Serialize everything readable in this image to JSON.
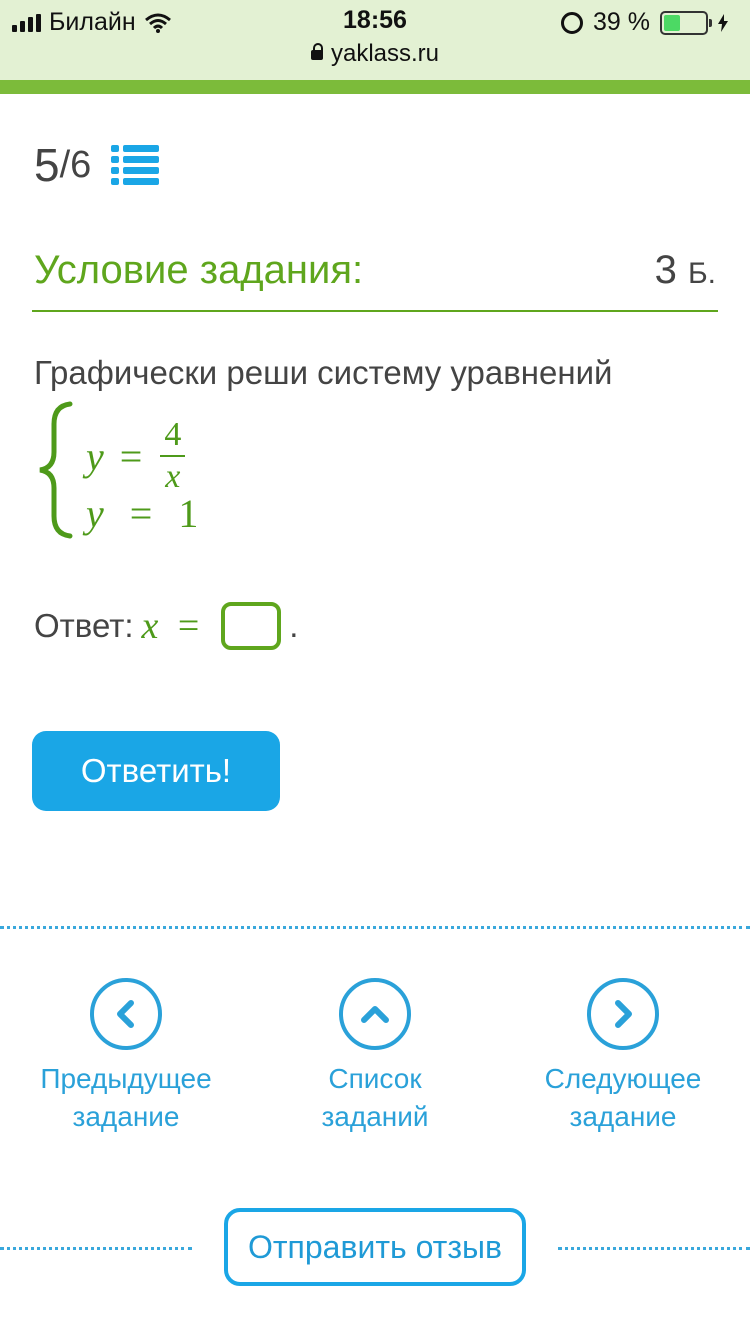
{
  "status_bar": {
    "carrier": "Билайн",
    "time": "18:56",
    "battery_percent": "39 %",
    "battery_level": 0.39,
    "url": "yaklass.ru"
  },
  "progress": {
    "current": "5",
    "total": "6"
  },
  "condition": {
    "title": "Условие задания:",
    "score": "3",
    "score_unit": "Б."
  },
  "task": {
    "text": "Графически реши систему уравнений",
    "eq1_left": "y",
    "eq1_sign": "=",
    "eq1_num": "4",
    "eq1_den": "x",
    "eq2_left": "y",
    "eq2_sign": "=",
    "eq2_right": "1"
  },
  "answer": {
    "label": "Ответ:",
    "var": "x",
    "sign": "=",
    "value": "",
    "suffix": "."
  },
  "submit_label": "Ответить!",
  "nav": {
    "prev_line1": "Предыдущее",
    "prev_line2": "задание",
    "list_line1": "Список",
    "list_line2": "заданий",
    "next_line1": "Следующее",
    "next_line2": "задание"
  },
  "feedback_label": "Отправить отзыв",
  "colors": {
    "accent_green": "#5fa61d",
    "accent_blue": "#1aa6e6"
  }
}
